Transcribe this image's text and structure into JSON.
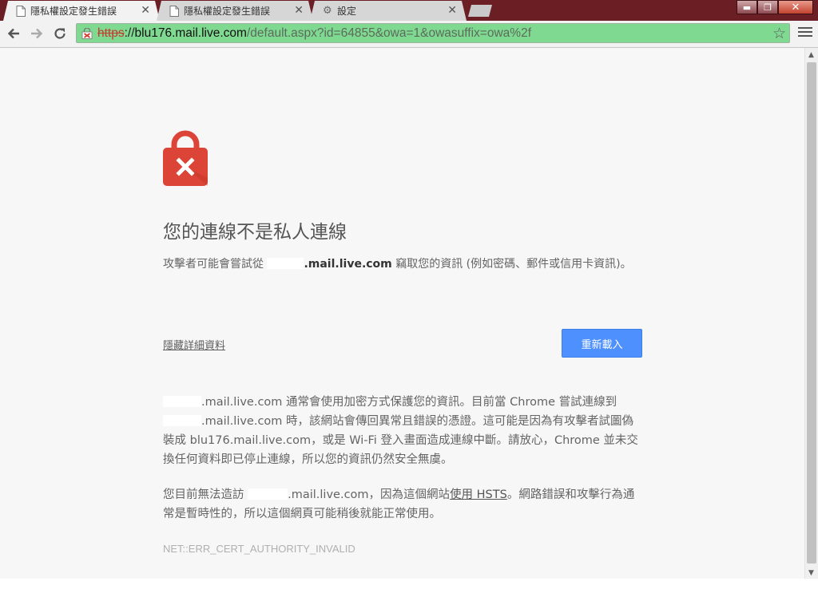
{
  "tabs": [
    {
      "label": "隱私權設定發生錯誤",
      "close": "✕",
      "icon": "page-icon",
      "active": true
    },
    {
      "label": "隱私權設定發生錯誤",
      "close": "✕",
      "icon": "page-icon",
      "active": false
    },
    {
      "label": "設定",
      "close": "✕",
      "icon": "gear-icon",
      "active": false
    }
  ],
  "window_controls": {
    "minimize": "▬",
    "maximize": "❐",
    "close": "✕"
  },
  "toolbar": {
    "back_icon": "back-arrow-icon",
    "forward_icon": "forward-arrow-icon",
    "reload_icon": "reload-icon",
    "url_scheme": "https",
    "url_separator": "://",
    "url_host": "blu176.mail.live.com",
    "url_path": "/default.aspx?id=64855&owa=1&owasuffix=owa%2f",
    "star_glyph": "☆"
  },
  "page": {
    "heading": "您的連線不是私人連線",
    "summary_before": "攻擊者可能會嘗試從 ",
    "summary_host_visible": ".mail.live.com",
    "summary_after": " 竊取您的資訊 (例如密碼、郵件或信用卡資訊)。",
    "details_link": "隱藏詳細資料",
    "reload_button": "重新載入",
    "detail_line1_host": ".mail.live.com",
    "detail_line1_text": " 通常會使用加密方式保護您的資訊。目前當 Chrome 嘗試連線到",
    "detail_line2_host": ".mail.live.com",
    "detail_line2_text": " 時，該網站會傳回異常且錯誤的憑證。這可能是因為有攻擊者試圖偽裝成 blu176.mail.live.com，或是 Wi-Fi 登入畫面造成連線中斷。請放心，Chrome 並未交換任何資料即已停止連線，所以您的資訊仍然安全無虞。",
    "hsts_before": "您目前無法造訪 ",
    "hsts_host_visible": ".mail.live.com",
    "hsts_middle": "，因為這個網站",
    "hsts_link": "使用 HSTS",
    "hsts_after": "。網路錯誤和攻擊行為通常是暫時性的，所以這個網頁可能稍後就能正常使用。",
    "error_code": "NET::ERR_CERT_AUTHORITY_INVALID"
  },
  "colors": {
    "omnibox_bg": "#80d990",
    "reload_button_bg": "#4d90fe",
    "lock_red": "#dc4437",
    "tabstrip_bg": "#6b1e23"
  }
}
